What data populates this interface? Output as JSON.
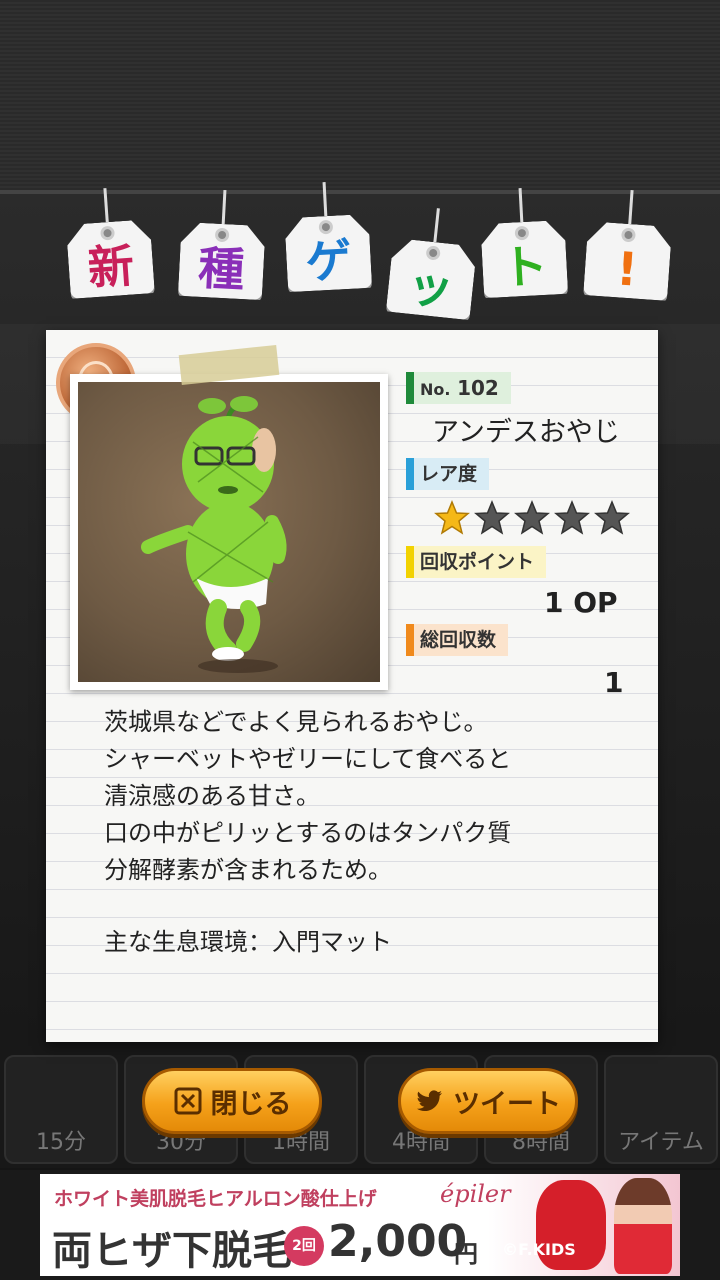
{
  "header_tags": {
    "chars": [
      "新",
      "種",
      "ゲ",
      "ッ",
      "ト",
      "!"
    ],
    "colors": [
      "#c8205a",
      "#8a2fb8",
      "#1a7ad0",
      "#11a046",
      "#2fb020",
      "#f07010"
    ]
  },
  "card": {
    "number_label": "No.",
    "number_value": "102",
    "name": "アンデスおやじ",
    "rarity_label": "レア度",
    "rarity_value": 1,
    "rarity_max": 5,
    "points_label": "回収ポイント",
    "points_value": "1 OP",
    "total_label": "総回収数",
    "total_value": "1",
    "description": "茨城県などでよく見られるおやじ。\nシャーベットやゼリーにして食べると\n清涼感のある甘さ。\n口の中がピリッとするのはタンパク質\n分解酵素が含まれるため。",
    "habitat": "主な生息環境：入門マット",
    "label_colors": {
      "number": "#1f8a3a",
      "rarity": "#2aa0d8",
      "points": "#f2d200",
      "total": "#f08a1c"
    }
  },
  "buttons": {
    "close_label": "閉じる",
    "tweet_label": "ツイート"
  },
  "background_slots": [
    "15分",
    "30分",
    "1時間",
    "4時間",
    "8時間",
    "アイテム"
  ],
  "ad": {
    "top_text": "ホワイト美肌脱毛ヒアルロン酸仕上げ",
    "brand": "épiler",
    "main_text": "両ヒザ下脱毛",
    "badge": "2回",
    "price": "2,000",
    "yen": "円",
    "credit": "©F.KIDS"
  }
}
